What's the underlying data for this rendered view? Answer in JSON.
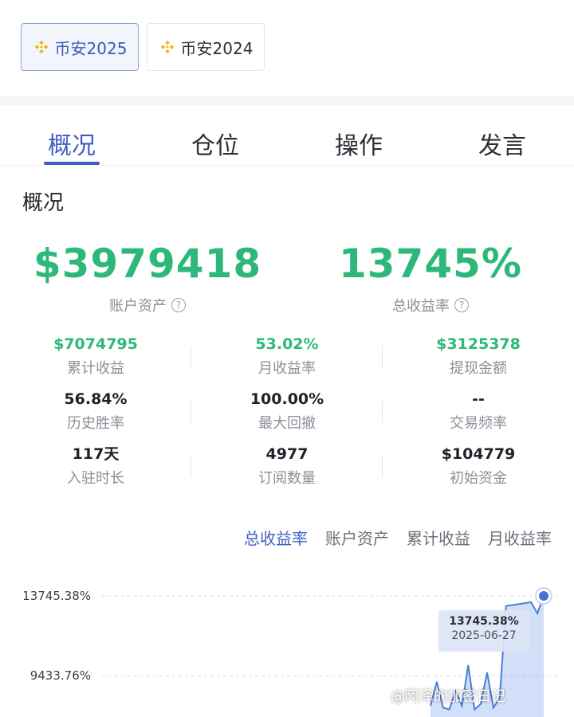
{
  "year_tabs": [
    {
      "label": "币安2025",
      "active": true
    },
    {
      "label": "币安2024",
      "active": false
    }
  ],
  "main_tabs": [
    {
      "label": "概况",
      "active": true
    },
    {
      "label": "仓位",
      "active": false
    },
    {
      "label": "操作",
      "active": false
    },
    {
      "label": "发言",
      "active": false
    }
  ],
  "section_title": "概况",
  "overview": {
    "account_assets": {
      "value": "$3979418",
      "label": "账户资产"
    },
    "total_return": {
      "value": "13745%",
      "label": "总收益率"
    }
  },
  "stats": [
    [
      {
        "value": "$7074795",
        "label": "累计收益",
        "green": true
      },
      {
        "value": "53.02%",
        "label": "月收益率",
        "green": true
      },
      {
        "value": "$3125378",
        "label": "提现金额",
        "green": true
      }
    ],
    [
      {
        "value": "56.84%",
        "label": "历史胜率",
        "green": false
      },
      {
        "value": "100.00%",
        "label": "最大回撤",
        "green": false
      },
      {
        "value": "--",
        "label": "交易频率",
        "green": false
      }
    ],
    [
      {
        "value": "117天",
        "label": "入驻时长",
        "green": false
      },
      {
        "value": "4977",
        "label": "订阅数量",
        "green": false
      },
      {
        "value": "$104779",
        "label": "初始资金",
        "green": false
      }
    ]
  ],
  "chart_tabs": [
    {
      "label": "总收益率",
      "active": true
    },
    {
      "label": "账户资产",
      "active": false
    },
    {
      "label": "累计收益",
      "active": false
    },
    {
      "label": "月收益率",
      "active": false
    }
  ],
  "chart_data": {
    "type": "area",
    "y_ticks": [
      "13745.38%",
      "9433.76%"
    ],
    "y_tick_values": [
      13745.38,
      9433.76
    ],
    "x": [
      0,
      1,
      2,
      3,
      4,
      5,
      6,
      7,
      8,
      9,
      10,
      11,
      12,
      13,
      14,
      15,
      16,
      17,
      18
    ],
    "values": [
      7800,
      9100,
      7700,
      7600,
      8600,
      7800,
      10000,
      7600,
      7900,
      9600,
      7700,
      8200,
      13200,
      13250,
      13300,
      13350,
      13400,
      12800,
      13745.38
    ],
    "tooltip": {
      "value": "13745.38%",
      "date": "2025-06-27"
    },
    "color": "#4a7fd9"
  },
  "watermark": "@阿泽的加密日记",
  "colors": {
    "accent": "#3f5fc0",
    "positive": "#2db87a",
    "bnb": "#f0b90b"
  }
}
